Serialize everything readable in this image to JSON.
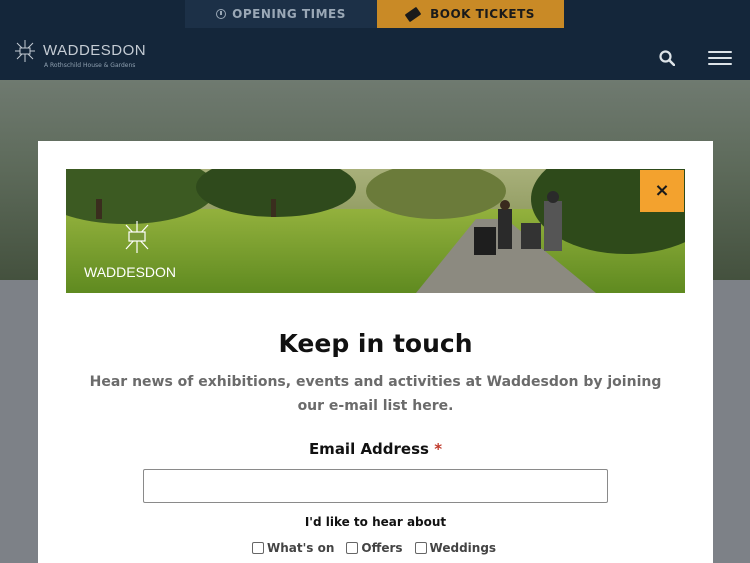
{
  "topbar": {
    "opening_label": "OPENING TIMES",
    "book_label": "BOOK TICKETS",
    "opening_icon": "clock-icon",
    "book_icon": "ticket-icon"
  },
  "header": {
    "logo_title": "WADDESDON",
    "logo_subtitle": "A Rothschild House & Gardens",
    "search_icon": "search-icon",
    "menu_icon": "hamburger-menu-icon"
  },
  "modal": {
    "banner_logo_text": "WADDESDON",
    "close_label": "×",
    "title": "Keep in touch",
    "intro": "Hear news of exhibitions, events and activities at Waddesdon by joining our e-mail list here.",
    "email_label": "Email Address",
    "email_required_mark": "*",
    "email_value": "",
    "hear_about_label": "I'd like to hear about",
    "options": [
      "What's on",
      "Offers",
      "Weddings"
    ]
  },
  "colors": {
    "navy": "#14263a",
    "book_orange": "#c98a26",
    "close_orange": "#f3a22e"
  }
}
